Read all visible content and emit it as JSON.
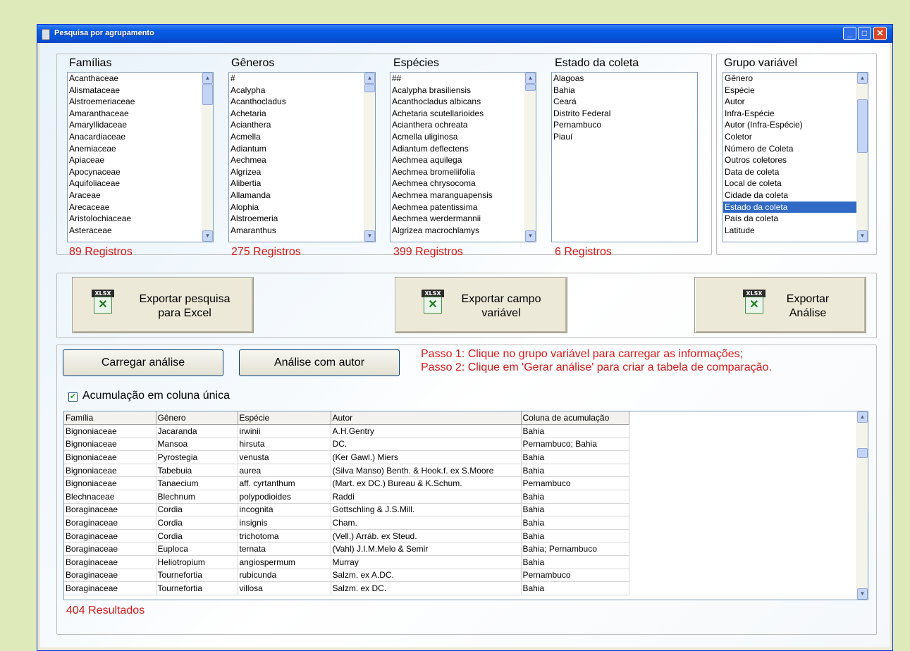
{
  "window": {
    "title": "Pesquisa por agrupamento"
  },
  "families": {
    "label": "Famílias",
    "items": [
      "Acanthaceae",
      "Alismataceae",
      "Alstroemeriaceae",
      "Amaranthaceae",
      "Amaryllidaceae",
      "Anacardiaceae",
      "Anemiaceae",
      "Apiaceae",
      "Apocynaceae",
      "Aquifoliaceae",
      "Araceae",
      "Arecaceae",
      "Aristolochiaceae",
      "Asteraceae"
    ],
    "count": "89 Registros"
  },
  "genera": {
    "label": "Gêneros",
    "items": [
      "#",
      "Acalypha",
      "Acanthocladus",
      "Achetaria",
      "Acianthera",
      "Acmella",
      "Adiantum",
      "Aechmea",
      "Algrizea",
      "Alibertia",
      "Allamanda",
      "Alophia",
      "Alstroemeria",
      "Amaranthus"
    ],
    "count": "275 Registros"
  },
  "species": {
    "label": "Espécies",
    "items": [
      "##",
      "Acalypha brasiliensis",
      "Acanthocladus albicans",
      "Achetaria scutellarioides",
      "Acianthera ochreata",
      "Acmella uliginosa",
      "Adiantum deflectens",
      "Aechmea aquilega",
      "Aechmea bromeliifolia",
      "Aechmea chrysocoma",
      "Aechmea maranguapensis",
      "Aechmea patentissima",
      "Aechmea werdermannii",
      "Algrizea macrochlamys"
    ],
    "count": "399 Registros"
  },
  "states": {
    "label": "Estado da coleta",
    "items": [
      "Alagoas",
      "Bahia",
      "Ceará",
      "Distrito Federal",
      "Pernambuco",
      "Piauí"
    ],
    "count": "6 Registros"
  },
  "variable_group": {
    "label": "Grupo variável",
    "items": [
      "Gênero",
      "Espécie",
      "Autor",
      "Infra-Espécie",
      "Autor (Infra-Espécie)",
      "Coletor",
      "Número de Coleta",
      "Outros coletores",
      "Data de coleta",
      "Local de coleta",
      "Cidade da coleta",
      "Estado da coleta",
      "País da coleta",
      "Latitude"
    ],
    "selected": "Estado da coleta"
  },
  "export": {
    "icon_tag": "XLSX",
    "search_line1": "Exportar pesquisa",
    "search_line2": "para Excel",
    "field_line1": "Exportar campo",
    "field_line2": "variável",
    "analysis_line1": "Exportar",
    "analysis_line2": "Análise"
  },
  "analysis": {
    "load_button": "Carregar análise",
    "author_button": "Análise com autor",
    "step1": "Passo 1: Clique no grupo variável para carregar as informações;",
    "step2": "Passo 2: Clique em 'Gerar análise' para criar a tabela de comparação.",
    "single_column_label": "Acumulação em coluna única",
    "single_column_checked": true
  },
  "results": {
    "columns": [
      "Família",
      "Gênero",
      "Espécie",
      "Autor",
      "Coluna de acumulação"
    ],
    "rows": [
      [
        "Bignoniaceae",
        "Jacaranda",
        "irwinii",
        "A.H.Gentry",
        "Bahia"
      ],
      [
        "Bignoniaceae",
        "Mansoa",
        "hirsuta",
        "DC.",
        "Pernambuco; Bahia"
      ],
      [
        "Bignoniaceae",
        "Pyrostegia",
        "venusta",
        "(Ker Gawl.) Miers",
        "Bahia"
      ],
      [
        "Bignoniaceae",
        "Tabebuia",
        "aurea",
        "(Silva Manso) Benth. & Hook.f. ex S.Moore",
        "Bahia"
      ],
      [
        "Bignoniaceae",
        "Tanaecium",
        "aff. cyrtanthum",
        "(Mart. ex DC.) Bureau & K.Schum.",
        "Pernambuco"
      ],
      [
        "Blechnaceae",
        "Blechnum",
        "polypodioides",
        "Raddi",
        "Bahia"
      ],
      [
        "Boraginaceae",
        "Cordia",
        "incognita",
        "Gottschling & J.S.Mill.",
        "Bahia"
      ],
      [
        "Boraginaceae",
        "Cordia",
        "insignis",
        "Cham.",
        "Bahia"
      ],
      [
        "Boraginaceae",
        "Cordia",
        "trichotoma",
        "(Vell.) Arráb. ex Steud.",
        "Bahia"
      ],
      [
        "Boraginaceae",
        "Euploca",
        "ternata",
        "(Vahl) J.I.M.Melo & Semir",
        "Bahia; Pernambuco"
      ],
      [
        "Boraginaceae",
        "Heliotropium",
        "angiospermum",
        "Murray",
        "Bahia"
      ],
      [
        "Boraginaceae",
        "Tournefortia",
        "rubicunda",
        "Salzm. ex A.DC.",
        "Pernambuco"
      ],
      [
        "Boraginaceae",
        "Tournefortia",
        "villosa",
        "Salzm. ex DC.",
        "Bahia"
      ]
    ],
    "count": "404 Resultados"
  },
  "colors": {
    "accent": "#316ac5",
    "alert": "#d21919",
    "background": "#dfeabb"
  }
}
